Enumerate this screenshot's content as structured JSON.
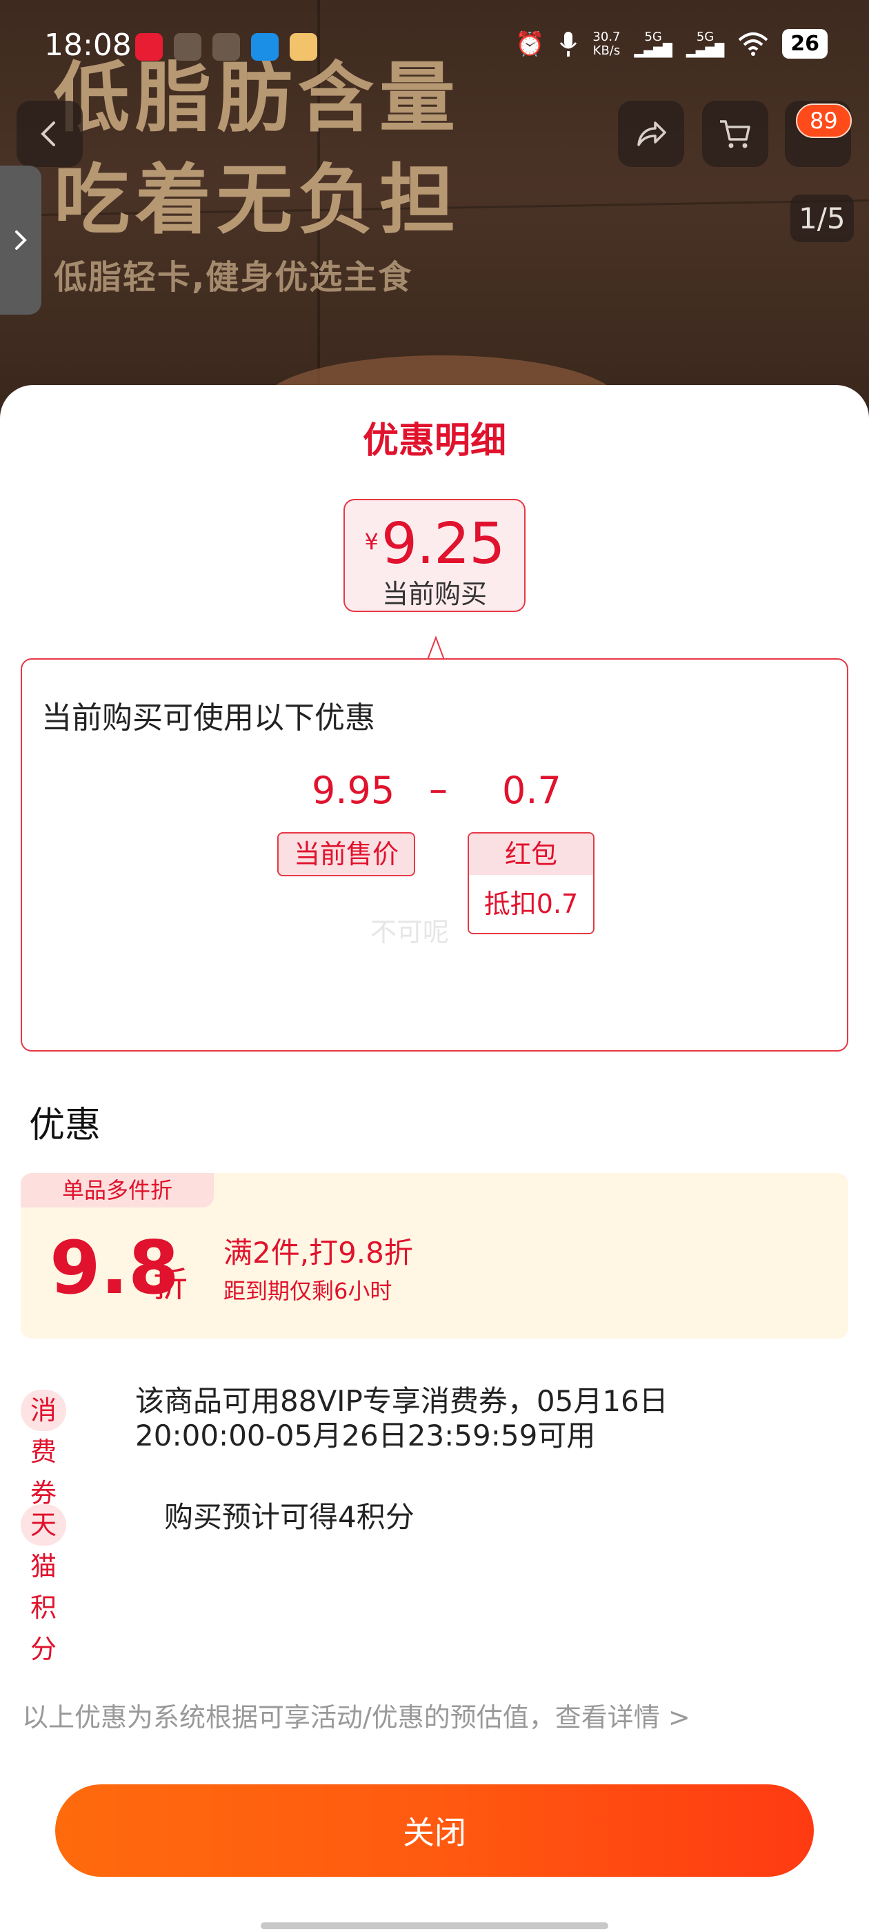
{
  "status_bar": {
    "time": "18:08",
    "net_speed_value": "30.7",
    "net_speed_unit": "KB/s",
    "signal_1": "5G",
    "signal_2": "5G",
    "battery": "26"
  },
  "product": {
    "headline_line1": "低脂肪含量",
    "headline_line2": "吃着无负担",
    "subline": "低脂轻卡,健身优选主食",
    "cart_badge": "89",
    "page_indicator": "1/5"
  },
  "sheet": {
    "title": "优惠明细",
    "price": {
      "currency": "¥",
      "value": "9.25",
      "label": "当前购买"
    },
    "detail": {
      "heading": "当前购买可使用以下优惠",
      "original_value": "9.95",
      "minus": "–",
      "discount_value": "0.7",
      "original_tag": "当前售价",
      "discount_tag_top": "红包",
      "discount_tag_bottom": "抵扣0.7",
      "watermark": "不可呢"
    },
    "section_title": "优惠",
    "multi_buy": {
      "tag": "单品多件折",
      "number": "9.8",
      "unit": "折",
      "main_text": "满2件,打9.8折",
      "sub_text": "距到期仅剩6小时"
    },
    "promos": [
      {
        "tag": "消费券",
        "text_line1": "该商品可用88VIP专享消费券，05月16日",
        "text_line2": "20:00:00-05月26日23:59:59可用"
      },
      {
        "tag": "天猫积分",
        "text_line1": "购买预计可得4积分"
      }
    ],
    "disclaimer": "以上优惠为系统根据可享活动/优惠的预估值，查看详情 >",
    "close_label": "关闭"
  },
  "colors": {
    "accent_red": "#e0122d",
    "button_gradient_start": "#ff6a0d",
    "button_gradient_end": "#ff3a12",
    "coupon_bg": "#fff7e3"
  },
  "icons": [
    "back-icon",
    "share-icon",
    "cart-icon",
    "more-icon",
    "chevron-right-icon",
    "wifi-icon",
    "alarm-icon",
    "mic-icon"
  ]
}
